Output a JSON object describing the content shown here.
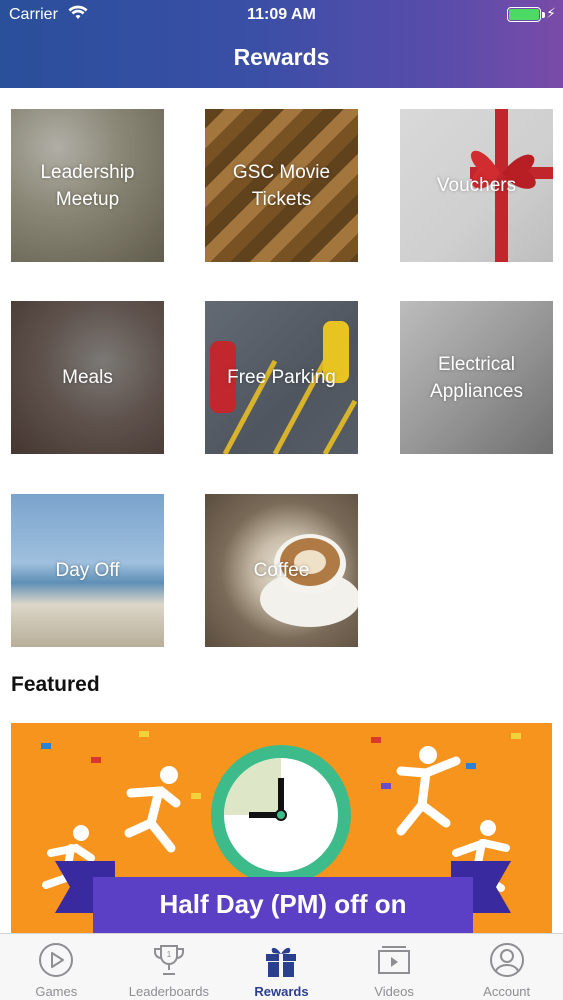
{
  "status_bar": {
    "carrier": "Carrier",
    "time": "11:09 AM",
    "battery_level": 1.0
  },
  "nav": {
    "title": "Rewards"
  },
  "rewards": [
    {
      "label_lines": [
        "Leadership",
        "Meetup"
      ]
    },
    {
      "label_lines": [
        "GSC Movie",
        "Tickets"
      ]
    },
    {
      "label_lines": [
        "Vouchers"
      ]
    },
    {
      "label_lines": [
        "Meals"
      ]
    },
    {
      "label_lines": [
        "Free Parking"
      ]
    },
    {
      "label_lines": [
        "Electrical",
        "Appliances"
      ]
    },
    {
      "label_lines": [
        "Day Off"
      ]
    },
    {
      "label_lines": [
        "Coffee"
      ]
    }
  ],
  "featured": {
    "heading": "Featured",
    "banner_text": "Half Day (PM) off on"
  },
  "tabbar": {
    "active": "Rewards",
    "tabs": [
      {
        "label": "Games",
        "icon": "play-circle-icon"
      },
      {
        "label": "Leaderboards",
        "icon": "trophy-icon"
      },
      {
        "label": "Rewards",
        "icon": "gift-icon"
      },
      {
        "label": "Videos",
        "icon": "video-icon"
      },
      {
        "label": "Account",
        "icon": "user-icon"
      }
    ]
  },
  "colors": {
    "header_start": "#2a4f9b",
    "header_end": "#7a4ba8",
    "active_tab": "#2b3f8f",
    "inactive_tab": "#8e8e93",
    "banner_bg": "#f7941d",
    "banner_ribbon": "#5b3fc4",
    "battery": "#4cd964"
  }
}
